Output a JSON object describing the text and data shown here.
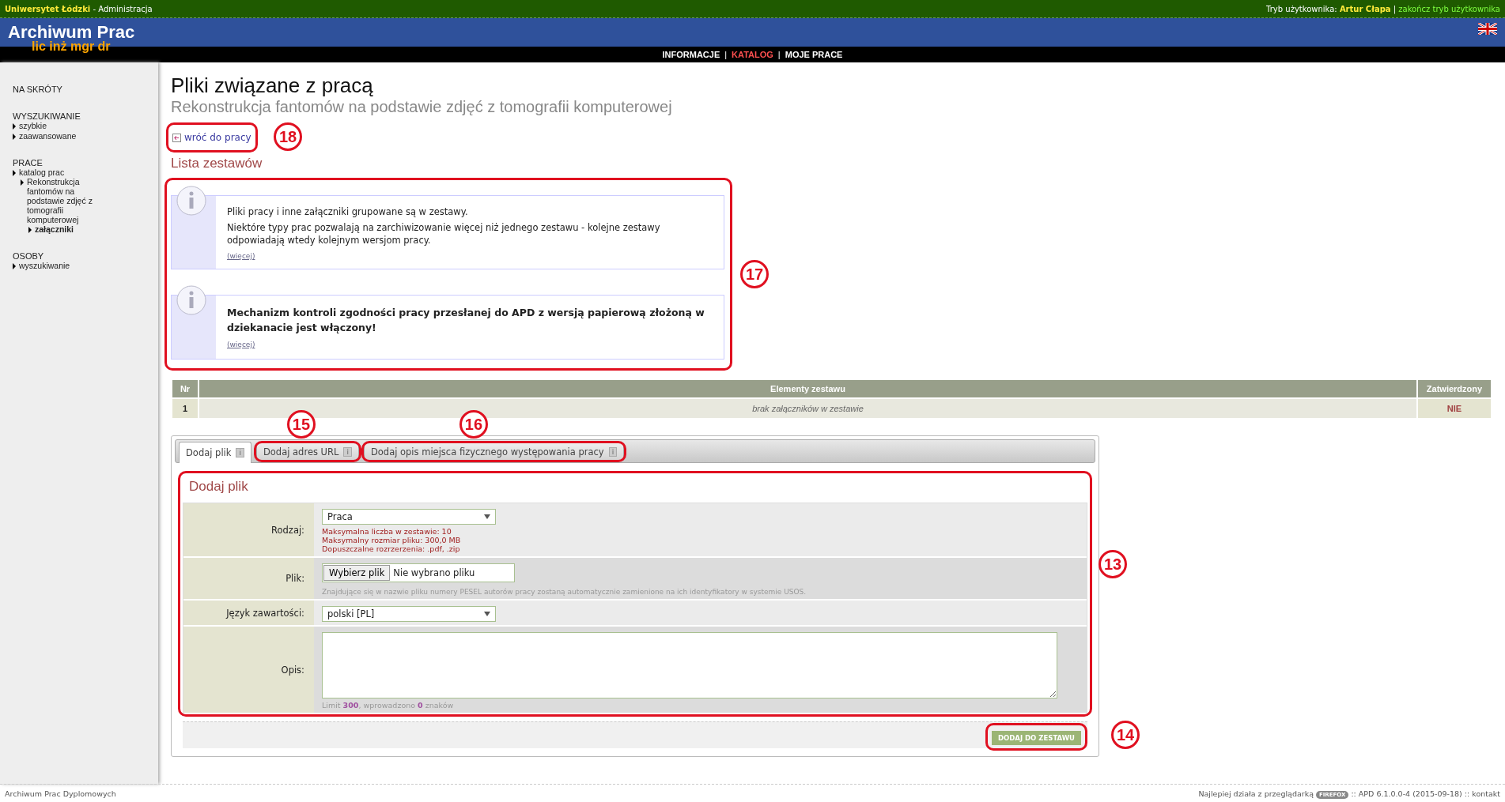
{
  "topbar": {
    "university": "Uniwersytet Łódzki",
    "separator": " - ",
    "section": "Administracja",
    "mode_label": "Tryb użytkownika:",
    "user": "Artur Cłapa",
    "divider": "|",
    "end_mode": "zakończ tryb użytkownika"
  },
  "header": {
    "title": "Archiwum Prac",
    "subtitle": "lic inż mgr dr"
  },
  "nav": [
    {
      "label": "INFORMACJE",
      "selected": false
    },
    {
      "label": "KATALOG",
      "selected": true
    },
    {
      "label": "MOJE PRACE",
      "selected": false
    }
  ],
  "nav_separator": "|",
  "sidebar": [
    {
      "heading": "NA SKRÓTY"
    },
    {
      "heading": "WYSZUKIWANIE",
      "items": [
        {
          "label": "szybkie",
          "selected": false
        },
        {
          "label": "zaawansowane",
          "selected": false
        }
      ]
    },
    {
      "heading": "PRACE",
      "items": [
        {
          "label": "katalog prac",
          "selected": false,
          "children": [
            {
              "label": "Rekonstrukcja fantomów na podstawie zdjęć z tomografii komputerowej",
              "selected": false,
              "children": [
                {
                  "label": "załączniki",
                  "selected": true
                }
              ]
            }
          ]
        }
      ]
    },
    {
      "heading": "OSOBY",
      "items": [
        {
          "label": "wyszukiwanie",
          "selected": false
        }
      ]
    }
  ],
  "page": {
    "title": "Pliki związane z pracą",
    "subtitle": "Rekonstrukcja fantomów na podstawie zdjęć z tomografii komputerowej"
  },
  "back_link": {
    "label": "wróć do pracy",
    "callout": "18"
  },
  "list_heading": "Lista zestawów",
  "info_group": {
    "callout": "17",
    "boxes": [
      {
        "paragraphs": [
          "Pliki pracy i inne załączniki grupowane są w zestawy.",
          "Niektóre typy prac pozwalają na zarchiwizowanie więcej niż jednego zestawu - kolejne zestawy odpowiadają wtedy kolejnym wersjom pracy."
        ],
        "bold": false,
        "more": "(więcej)"
      },
      {
        "paragraphs": [
          "Mechanizm kontroli zgodności pracy przesłanej do APD z wersją papierową złożoną w dziekanacie jest włączony!"
        ],
        "bold": true,
        "more": "(więcej)"
      }
    ]
  },
  "table": {
    "columns": [
      "Nr",
      "Elementy zestawu",
      "Zatwierdzony"
    ],
    "rows": [
      {
        "nr": "1",
        "elements": "brak załączników w zestawie",
        "approved": "NIE"
      }
    ]
  },
  "tabs": [
    {
      "label": "Dodaj plik",
      "info": "i",
      "selected": true
    },
    {
      "label": "Dodaj adres URL",
      "info": "i",
      "selected": false,
      "callout": "15"
    },
    {
      "label": "Dodaj opis miejsca fizycznego występowania pracy",
      "info": "i",
      "selected": false,
      "callout": "16"
    }
  ],
  "form": {
    "title": "Dodaj plik",
    "callout": "13",
    "rows": [
      {
        "kind": "select",
        "label": "Rodzaj:",
        "value": "Praca",
        "notes": [
          "Maksymalna liczba w zestawie: 10",
          "Maksymalny rozmiar pliku: 300,0 MB",
          "Dopuszczalne rozrzerzenia: .pdf, .zip"
        ]
      },
      {
        "kind": "file",
        "label": "Plik:",
        "button": "Wybierz plik",
        "value": "Nie wybrano pliku",
        "hint": "Znajdujące się w nazwie pliku numery PESEL autorów pracy zostaną automatycznie zamienione na ich identyfikatory w systemie USOS."
      },
      {
        "kind": "select",
        "label": "Język zawartości:",
        "value": "polski [PL]"
      },
      {
        "kind": "textarea",
        "label": "Opis:",
        "counter": "Limit **300**, wprowadzono **0** znaków"
      }
    ]
  },
  "submit": {
    "label": "DODAJ DO ZESTAWU",
    "callout": "14"
  },
  "footer": {
    "left": "Archiwum Prac Dyplomowych",
    "browser_text": "Najlepiej działa z przeglądarką",
    "browser_badge": "FIREFOX",
    "version": ":: APD 6.1.0.0-4 (2015-09-18) ::",
    "contact": "kontakt"
  }
}
